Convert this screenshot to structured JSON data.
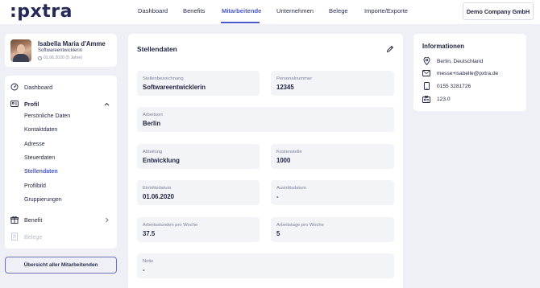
{
  "logo": ":pxtra",
  "nav": {
    "items": [
      {
        "label": "Dashboard"
      },
      {
        "label": "Benefits"
      },
      {
        "label": "Mitarbeitende",
        "active": true
      },
      {
        "label": "Unternehmen"
      },
      {
        "label": "Belege"
      },
      {
        "label": "Importe/Exporte"
      }
    ],
    "company": "Demo Company GmbH"
  },
  "profile": {
    "name": "Isabella Maria d'Amme",
    "role": "Softwareentwicklerin",
    "since": "01.06.2020 (5 Jahre)"
  },
  "sidebar": {
    "dashboard": "Dashboard",
    "profil": "Profil",
    "sub_items": [
      {
        "label": "Persönliche Daten"
      },
      {
        "label": "Kontaktdaten"
      },
      {
        "label": "Adresse"
      },
      {
        "label": "Steuerdaten"
      },
      {
        "label": "Stellendaten",
        "active": true
      },
      {
        "label": "Profilbild"
      },
      {
        "label": "Gruppierungen"
      }
    ],
    "benefit": "Benefit",
    "belege": "Belege",
    "overview_button": "Übersicht aller Mitarbeitenden"
  },
  "main": {
    "title": "Stellendaten",
    "fields": {
      "stellenbezeichnung": {
        "label": "Stellenbezeichnung",
        "value": "Softwareentwicklerin"
      },
      "personalnummer": {
        "label": "Personalnummer",
        "value": "12345"
      },
      "arbeitsort": {
        "label": "Arbeitsort",
        "value": "Berlin"
      },
      "abteilung": {
        "label": "Abteilung",
        "value": "Entwicklung"
      },
      "kostenstelle": {
        "label": "Kostenstelle",
        "value": "1000"
      },
      "eintrittsdatum": {
        "label": "Eintrittsdatum",
        "value": "01.06.2020"
      },
      "austrittsdatum": {
        "label": "Austrittsdatum",
        "value": "-"
      },
      "arbeitsstunden": {
        "label": "Arbeitsstunden pro Woche",
        "value": "37.5"
      },
      "arbeitstage": {
        "label": "Arbeitstage pro Woche",
        "value": "5"
      },
      "notiz": {
        "label": "Notiz",
        "value": "-"
      }
    }
  },
  "info": {
    "title": "Informationen",
    "location": "Berlin, Deutschland",
    "email": "messe+isabelle@pxtra.de",
    "phone": "0155 3281726",
    "id": "123.0"
  },
  "colors": {
    "accent": "#4b57c9",
    "background": "#eef0f5",
    "text": "#1f2340",
    "field_bg": "#f3f4f8"
  }
}
